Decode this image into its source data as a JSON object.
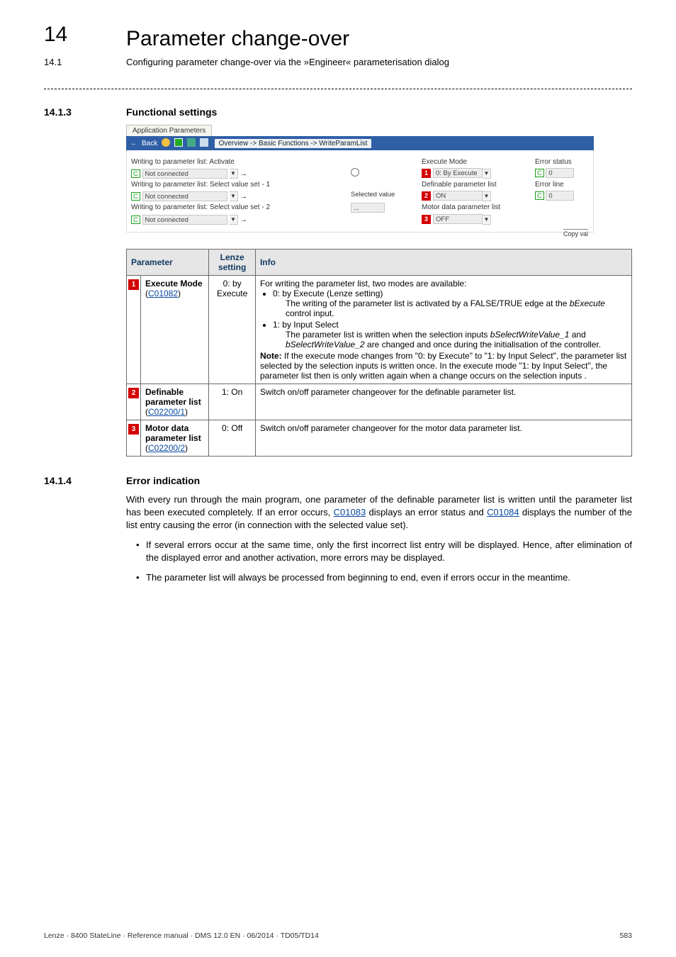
{
  "header": {
    "chapter_num": "14",
    "chapter_title": "Parameter change-over",
    "sub_num": "14.1",
    "sub_title": "Configuring parameter change-over via the »Engineer« parameterisation dialog"
  },
  "sec143": {
    "num": "14.1.3",
    "title": "Functional settings"
  },
  "sec144": {
    "num": "14.1.4",
    "title": "Error indication"
  },
  "app": {
    "tab": "Application Parameters",
    "back": "Back",
    "crumb": "Overview -> Basic Functions -> WriteParamList",
    "l_activate": "Writing to parameter list: Activate",
    "l_sel1": "Writing to parameter list: Select value set - 1",
    "l_sel2": "Writing to parameter list: Select value set - 2",
    "not_conn": "Not connected",
    "sel_val": "Selected value",
    "dots": "...",
    "l_exec": "Execute Mode",
    "v_exec": "0: By Execute",
    "l_def": "Definable parameter list",
    "v_def": "ON",
    "l_motor": "Motor data parameter list",
    "v_motor": "OFF",
    "l_estat": "Error status",
    "l_eline": "Error line",
    "zero": "0",
    "c": "C",
    "copy": "Copy val",
    "b1": "1",
    "b2": "2",
    "b3": "3"
  },
  "tbl": {
    "h_param": "Parameter",
    "h_lenze": "Lenze setting",
    "h_info": "Info",
    "r1": {
      "b": "1",
      "name": "Execute Mode",
      "code": "C01082",
      "lenze": "0: by Execute",
      "info_lead": "For writing the parameter list, two modes are available:",
      "li0_head": "0: by Execute (Lenze setting)",
      "li0_d1": "The writing of the parameter list is activated by a FALSE/TRUE edge at the ",
      "li0_d1_i": "bExecute",
      "li0_d1_t": " control input.",
      "li1_head": "1: by Input Select",
      "li1_d1": "The parameter list is written when the selection inputs ",
      "li1_d1_i1": "bSelectWriteValue_1",
      "li1_d1_m": " and ",
      "li1_d1_i2": "bSelectWriteValue_2",
      "li1_d1_t": " are changed and once during the initialisation of the controller.",
      "note_b": "Note:",
      "note": " If the execute mode changes from \"0: by Execute\" to \"1: by Input Select\", the parameter list selected by the selection inputs is written once. In the execute mode \"1: by Input Select\", the parameter list then is only written again when a change occurs on the selection inputs  ."
    },
    "r2": {
      "b": "2",
      "name": "Definable parameter list",
      "code": "C02200/1",
      "lenze": "1: On",
      "info": "Switch on/off parameter changeover for the definable parameter list."
    },
    "r3": {
      "b": "3",
      "name": "Motor data parameter list",
      "code": "C02200/2",
      "lenze": "0: Off",
      "info": "Switch on/off parameter changeover for the motor data parameter list."
    }
  },
  "err": {
    "p1a": "With every run through the main program, one parameter of the definable parameter list is written until the parameter list has been executed completely. If an error occurs, ",
    "c1": "C01083",
    "p1b": " displays an error status and ",
    "c2": "C01084",
    "p1c": " displays the number of the list entry causing the error (in connection with the selected value set).",
    "b1": "If several errors occur at the same time, only the first incorrect list entry will be displayed. Hence, after elimination of the displayed error and another activation, more errors may be displayed.",
    "b2": "The parameter list will always be processed from beginning to end, even if errors occur in the meantime."
  },
  "footer": {
    "left": "Lenze · 8400 StateLine · Reference manual · DMS 12.0 EN · 06/2014 · TD05/TD14",
    "right": "583"
  }
}
